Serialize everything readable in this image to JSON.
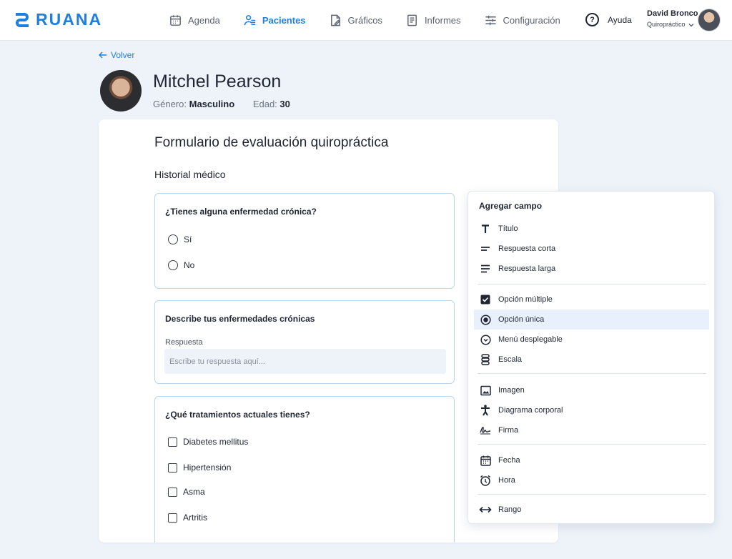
{
  "brand": {
    "name": "RUANA",
    "color": "#1f7fe0"
  },
  "nav": {
    "items": [
      {
        "label": "Agenda",
        "icon": "calendar-icon"
      },
      {
        "label": "Pacientes",
        "icon": "patients-icon"
      },
      {
        "label": "Gráficos",
        "icon": "chart-file-icon"
      },
      {
        "label": "Informes",
        "icon": "report-icon"
      },
      {
        "label": "Configuración",
        "icon": "sliders-icon"
      }
    ],
    "active": "Pacientes"
  },
  "help": {
    "label": "Ayuda",
    "icon": "question-circle-icon"
  },
  "user": {
    "name": "David Bronco",
    "role": "Quiropráctico",
    "icon": "chevron-down-icon"
  },
  "back": {
    "label": "Volver",
    "icon": "arrow-left-icon"
  },
  "patient": {
    "name": "Mitchel Pearson",
    "gender_label": "Género:",
    "gender": "Masculino",
    "age_label": "Edad:",
    "age": "30"
  },
  "form": {
    "title": "Formulario de evaluación quiropráctica",
    "section": "Historial médico",
    "q1": {
      "title": "¿Tienes alguna enfermedad crónica?",
      "options": [
        "Sí",
        "No"
      ]
    },
    "q2": {
      "title": "Describe tus enfermedades crónicas",
      "label": "Respuesta",
      "placeholder": "Escribe tu respuesta aquí..."
    },
    "q3": {
      "title": "¿Qué tratamientos actuales tienes?",
      "options": [
        "Diabetes mellitus",
        "Hipertensión",
        "Asma",
        "Artritis"
      ]
    }
  },
  "panel": {
    "title": "Agregar campo",
    "items": [
      {
        "label": "Título",
        "icon": "title-icon"
      },
      {
        "label": "Respuesta corta",
        "icon": "short-text-icon"
      },
      {
        "label": "Respuesta larga",
        "icon": "long-text-icon"
      },
      {
        "label": "Opción múltiple",
        "icon": "checkbox-icon"
      },
      {
        "label": "Opción única",
        "icon": "radio-icon"
      },
      {
        "label": "Menú desplegable",
        "icon": "dropdown-icon"
      },
      {
        "label": "Escala",
        "icon": "scale-icon"
      },
      {
        "label": "Imagen",
        "icon": "image-icon"
      },
      {
        "label": "Diagrama corporal",
        "icon": "body-icon"
      },
      {
        "label": "Firma",
        "icon": "signature-icon"
      },
      {
        "label": "Fecha",
        "icon": "calendar-icon"
      },
      {
        "label": "Hora",
        "icon": "alarm-icon"
      },
      {
        "label": "Rango",
        "icon": "range-icon"
      }
    ],
    "selected": "Opción única"
  }
}
